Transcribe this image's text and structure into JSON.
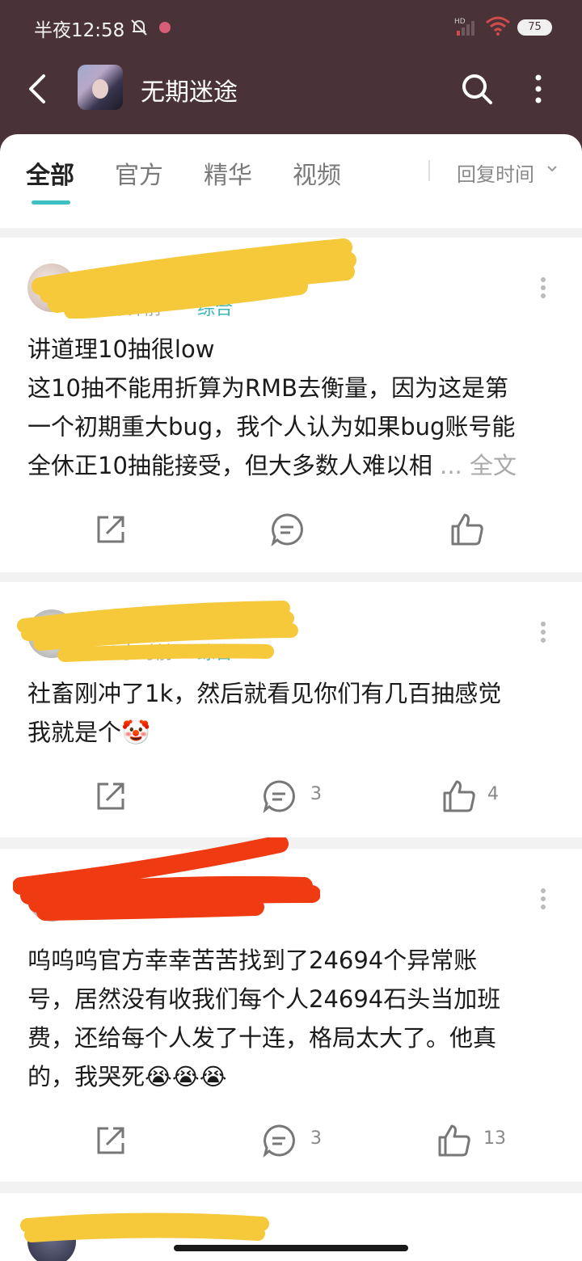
{
  "status_bar": {
    "time": "半夜12:58",
    "battery": "75",
    "network": "HD"
  },
  "header": {
    "title": "无期迷途"
  },
  "tabs": [
    {
      "label": "全部",
      "active": true
    },
    {
      "label": "官方",
      "active": false
    },
    {
      "label": "精华",
      "active": false
    },
    {
      "label": "视频",
      "active": false
    }
  ],
  "sort": {
    "label": "回复时间"
  },
  "posts": [
    {
      "time": "分钟前",
      "tag": "综合",
      "lines": [
        "讲道理10抽很low",
        "这10抽不能用折算为RMB去衡量，因为这是第",
        "一个初期重大bug，我个人认为如果bug账号能",
        "全休正10抽能接受，但大多数人难以相"
      ],
      "ellipsis": "...",
      "full_text": "全文",
      "comments": "",
      "likes": ""
    },
    {
      "time": "1小时前",
      "tag": "综合",
      "lines": [
        "社畜刚冲了1k，然后就看见你们有几百抽感觉",
        "我就是个🤡"
      ],
      "comments": "3",
      "likes": "4"
    },
    {
      "lines": [
        "呜呜呜官方幸幸苦苦找到了24694个异常账",
        "号，居然没有收我们每个人24694石头当加班",
        "费，还给每个人发了十连，格局太大了。他真",
        "的，我哭死😭😭😭"
      ],
      "comments": "3",
      "likes": "13"
    }
  ],
  "colors": {
    "header_bg": "#4a3338",
    "accent": "#3cc0c4",
    "tag": "#3cb6b9",
    "redaction_yellow": "#f6c93a",
    "redaction_red": "#f03a12"
  },
  "icons": [
    "back-icon",
    "search-icon",
    "more-vertical-icon",
    "share-icon",
    "comment-icon",
    "like-icon",
    "chevron-down-icon",
    "mute-bell-icon",
    "wifi-icon",
    "signal-icon"
  ]
}
